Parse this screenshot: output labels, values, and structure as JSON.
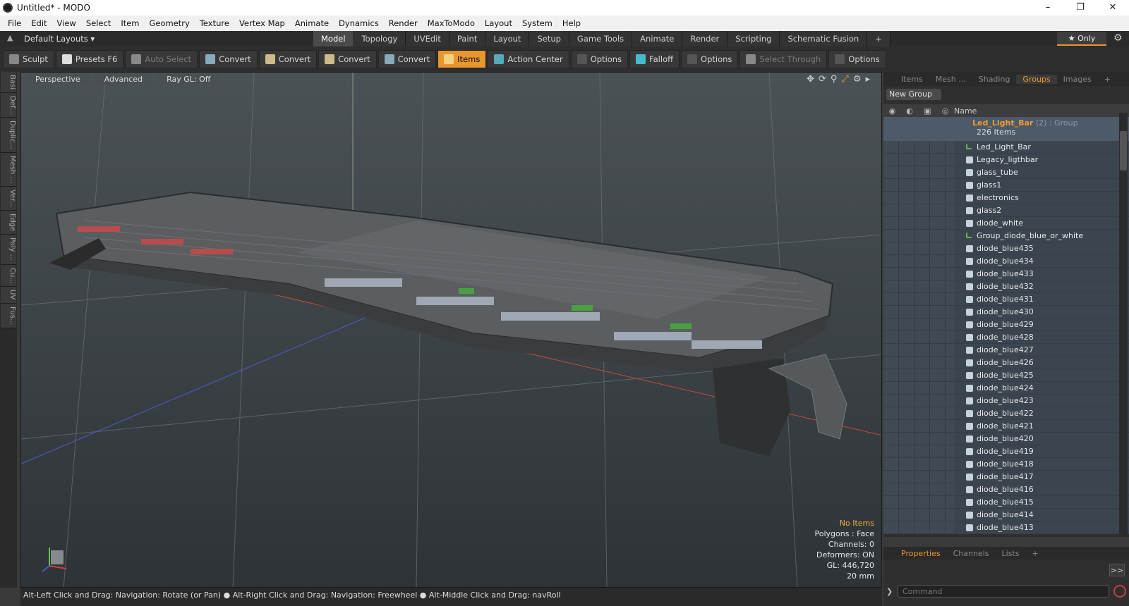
{
  "window": {
    "title": "Untitled* - MODO"
  },
  "menu": [
    "File",
    "Edit",
    "View",
    "Select",
    "Item",
    "Geometry",
    "Texture",
    "Vertex Map",
    "Animate",
    "Dynamics",
    "Render",
    "MaxToModo",
    "Layout",
    "System",
    "Help"
  ],
  "layout_bar": {
    "default_layouts": "Default Layouts ▾",
    "tabs": [
      "Model",
      "Topology",
      "UVEdit",
      "Paint",
      "Layout",
      "Setup",
      "Game Tools",
      "Animate",
      "Render",
      "Scripting",
      "Schematic Fusion",
      "+"
    ],
    "active_tab": "Model",
    "only_label": "★ Only"
  },
  "toolbar": {
    "items": [
      {
        "label": "Sculpt",
        "state": "normal"
      },
      {
        "label": "Presets  F6",
        "state": "normal"
      },
      {
        "label": "Auto Select",
        "state": "dim"
      },
      {
        "label": "Convert",
        "state": "normal"
      },
      {
        "label": "Convert",
        "state": "normal"
      },
      {
        "label": "Convert",
        "state": "normal"
      },
      {
        "label": "Convert",
        "state": "normal"
      },
      {
        "label": "Items",
        "state": "active"
      },
      {
        "label": "Action Center",
        "state": "normal"
      },
      {
        "label": "Options",
        "state": "normal"
      },
      {
        "label": "Falloff",
        "state": "normal"
      },
      {
        "label": "Options",
        "state": "normal"
      },
      {
        "label": "Select Through",
        "state": "dim"
      },
      {
        "label": "Options",
        "state": "normal"
      }
    ]
  },
  "left_strip": [
    "Basi",
    "Def...",
    "Duplic...",
    "Mesh ...",
    "Ver...",
    "Edge",
    "Poly ...",
    "Cu...",
    "UV",
    "Fus..."
  ],
  "viewport": {
    "header": [
      "Perspective",
      "Advanced",
      "Ray GL: Off"
    ],
    "info": {
      "selection": "No Items",
      "polygons": "Polygons : Face",
      "channels": "Channels: 0",
      "deformers": "Deformers: ON",
      "gl": "GL: 446,720",
      "scale": "20 mm"
    }
  },
  "status_bar": "Alt-Left Click and Drag: Navigation: Rotate (or Pan) ●  Alt-Right Click and Drag: Navigation: Freewheel ●  Alt-Middle Click and Drag: navRoll",
  "right_panel": {
    "tabs": [
      "Items",
      "Mesh ...",
      "Shading",
      "Groups",
      "Images",
      "+"
    ],
    "active_tab": "Groups",
    "new_group": "New Group",
    "column_name": "Name",
    "group": {
      "name": "Led_Light_Bar",
      "suffix": "(2) : Group",
      "count": "226 Items"
    },
    "items": [
      "Led_Light_Bar",
      "Legacy_ligthbar",
      "glass_tube",
      "glass1",
      "electronics",
      "glass2",
      "diode_white",
      "Group_diode_blue_or_white",
      "diode_blue435",
      "diode_blue434",
      "diode_blue433",
      "diode_blue432",
      "diode_blue431",
      "diode_blue430",
      "diode_blue429",
      "diode_blue428",
      "diode_blue427",
      "diode_blue426",
      "diode_blue425",
      "diode_blue424",
      "diode_blue423",
      "diode_blue422",
      "diode_blue421",
      "diode_blue420",
      "diode_blue419",
      "diode_blue418",
      "diode_blue417",
      "diode_blue416",
      "diode_blue415",
      "diode_blue414",
      "diode_blue413"
    ]
  },
  "properties_panel": {
    "tabs": [
      "Properties",
      "Channels",
      "Lists",
      "+"
    ],
    "active_tab": "Properties",
    "command_placeholder": "Command",
    "go_label": ">>"
  }
}
